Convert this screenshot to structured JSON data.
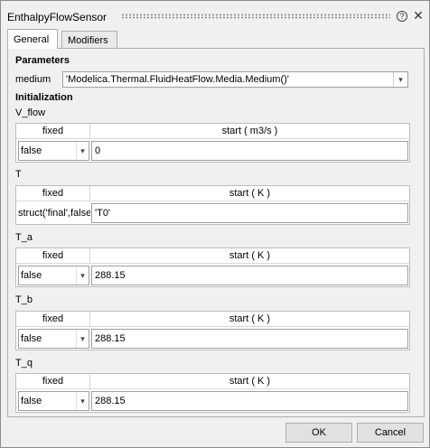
{
  "window": {
    "title": "EnthalpyFlowSensor"
  },
  "tabs": [
    "General",
    "Modifiers"
  ],
  "parameters": {
    "heading": "Parameters",
    "medium_label": "medium",
    "medium_value": "'Modelica.Thermal.FluidHeatFlow.Media.Medium()'"
  },
  "initialization": {
    "heading": "Initialization",
    "groups": [
      {
        "label": "V_flow",
        "fixed_header": "fixed",
        "start_header": "start ( m3/s )",
        "fixed_value": "false",
        "start_value": "0"
      },
      {
        "label": "T",
        "fixed_header": "fixed",
        "start_header": "start ( K )",
        "fixed_value": "struct('final',false",
        "start_value": "'T0'"
      },
      {
        "label": "T_a",
        "fixed_header": "fixed",
        "start_header": "start ( K )",
        "fixed_value": "false",
        "start_value": "288.15"
      },
      {
        "label": "T_b",
        "fixed_header": "fixed",
        "start_header": "start ( K )",
        "fixed_value": "false",
        "start_value": "288.15"
      },
      {
        "label": "T_q",
        "fixed_header": "fixed",
        "start_header": "start ( K )",
        "fixed_value": "false",
        "start_value": "288.15"
      }
    ]
  },
  "buttons": {
    "ok": "OK",
    "cancel": "Cancel"
  }
}
